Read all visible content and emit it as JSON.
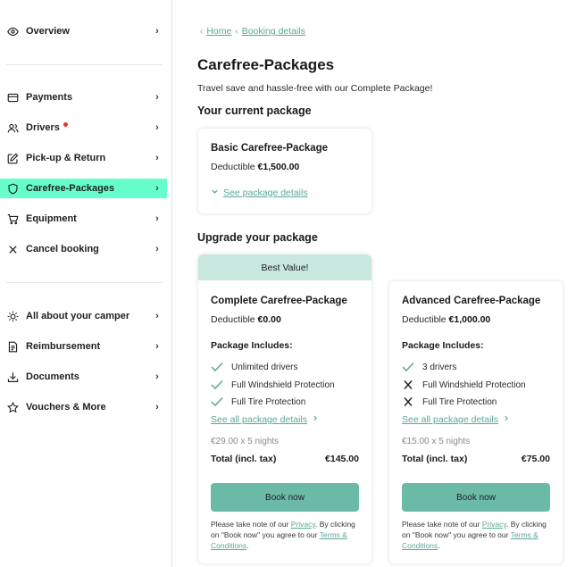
{
  "sidebar": {
    "group1": [
      {
        "label": "Overview",
        "icon": "eye-icon"
      }
    ],
    "group2": [
      {
        "label": "Payments",
        "icon": "credit-card-icon"
      },
      {
        "label": "Drivers",
        "icon": "users-icon"
      },
      {
        "label": "Pick-up & Return",
        "icon": "edit-icon"
      },
      {
        "label": "Carefree-Packages",
        "icon": "shield-icon"
      },
      {
        "label": "Equipment",
        "icon": "cart-icon"
      },
      {
        "label": "Cancel booking",
        "icon": "close-icon"
      }
    ],
    "group3": [
      {
        "label": "All about your camper",
        "icon": "sun-icon"
      },
      {
        "label": "Reimbursement",
        "icon": "receipt-icon"
      },
      {
        "label": "Documents",
        "icon": "download-icon"
      },
      {
        "label": "Vouchers & More",
        "icon": "star-icon"
      }
    ],
    "active_color": "#66ffcc",
    "notification_color": "#e8312f"
  },
  "breadcrumb": {
    "home": "Home",
    "current": "Booking details"
  },
  "page": {
    "title": "Carefree-Packages",
    "subtitle": "Travel save and hassle-free with our Complete Package!",
    "current_section": "Your current package",
    "upgrade_section": "Upgrade your package"
  },
  "current_package": {
    "name": "Basic Carefree-Package",
    "deductible_label": "Deductible",
    "deductible_value": "€1,500.00",
    "details_link": "See package details"
  },
  "packages": [
    {
      "badge": "Best Value!",
      "name": "Complete Carefree-Package",
      "deductible_label": "Deductible",
      "deductible_value": "€0.00",
      "includes_title": "Package Includes:",
      "features": [
        {
          "label": "Unlimited drivers",
          "included": true
        },
        {
          "label": "Full Windshield Protection",
          "included": true
        },
        {
          "label": "Full Tire Protection",
          "included": true
        }
      ],
      "details_link": "See all package details",
      "price_line": "€29.00 x 5 nights",
      "total_label": "Total (incl. tax)",
      "total_value": "€145.00",
      "book_label": "Book now",
      "note_prefix": "Please take note of our ",
      "privacy": "Privacy",
      "note_mid": ". By clicking on \"Book now\" you agree to our ",
      "terms": "Terms & Conditions",
      "note_suffix": "."
    },
    {
      "name": "Advanced Carefree-Package",
      "deductible_label": "Deductible",
      "deductible_value": "€1,000.00",
      "includes_title": "Package Includes:",
      "features": [
        {
          "label": "3 drivers",
          "included": true
        },
        {
          "label": "Full Windshield Protection",
          "included": false
        },
        {
          "label": "Full Tire Protection",
          "included": false
        }
      ],
      "details_link": "See all package details",
      "price_line": "€15.00 x 5 nights",
      "total_label": "Total (incl. tax)",
      "total_value": "€75.00",
      "book_label": "Book now",
      "note_prefix": "Please take note of our ",
      "privacy": "Privacy",
      "note_mid": ". By clicking on \"Book now\" you agree to our ",
      "terms": "Terms & Conditions",
      "note_suffix": "."
    }
  ],
  "colors": {
    "accent": "#5aa898",
    "button": "#6bbaa8",
    "badge_bg": "#c8e7df",
    "check": "#5aa898"
  }
}
